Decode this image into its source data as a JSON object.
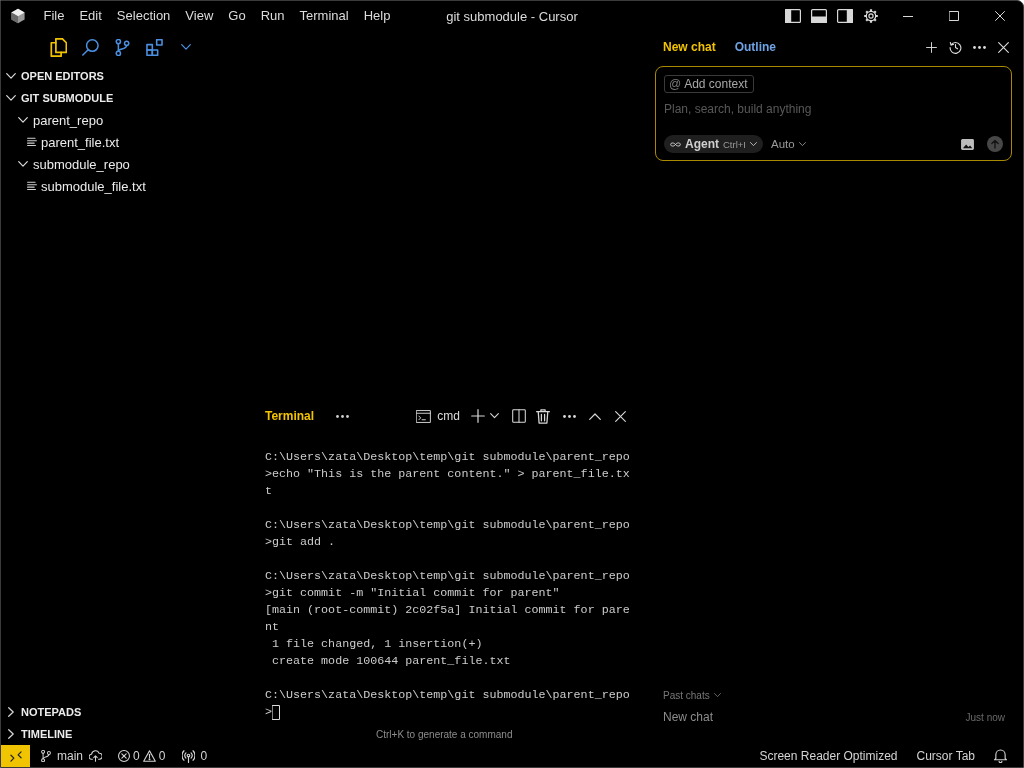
{
  "title_bar": {
    "menu": [
      "File",
      "Edit",
      "Selection",
      "View",
      "Go",
      "Run",
      "Terminal",
      "Help"
    ],
    "title": "git submodule - Cursor",
    "layout_toggles": [
      {
        "on": true
      },
      {
        "on": true
      },
      {
        "on": true
      }
    ]
  },
  "activity_bar": [
    {
      "selected": true
    },
    {
      "selected": false
    },
    {
      "selected": false
    },
    {
      "selected": false
    }
  ],
  "sidebar": {
    "sections": [
      {
        "label": "OPEN EDITORS",
        "expanded": true
      },
      {
        "label": "GIT SUBMODULE",
        "expanded": true,
        "children": [
          {
            "label": "parent_repo",
            "kind": "folder",
            "expanded": true,
            "children": [
              {
                "label": "parent_file.txt",
                "kind": "file"
              }
            ]
          },
          {
            "label": "submodule_repo",
            "kind": "folder",
            "expanded": true,
            "children": [
              {
                "label": "submodule_file.txt",
                "kind": "file"
              }
            ]
          }
        ]
      }
    ],
    "bottom_sections": [
      {
        "label": "NOTEPADS",
        "expanded": false
      },
      {
        "label": "TIMELINE",
        "expanded": false
      }
    ]
  },
  "panel": {
    "tabs": [
      {
        "label": "Terminal",
        "selected": true
      }
    ],
    "shell": "cmd",
    "terminal": {
      "blocks": [
        {
          "lines": [
            "C:\\Users\\zata\\Desktop\\temp\\git submodule\\parent_repo",
            ">echo \"This is the parent content.\" > parent_file.tx",
            "t"
          ]
        },
        {
          "lines": [
            "C:\\Users\\zata\\Desktop\\temp\\git submodule\\parent_repo",
            ">git add ."
          ]
        },
        {
          "lines": [
            "C:\\Users\\zata\\Desktop\\temp\\git submodule\\parent_repo",
            ">git commit -m \"Initial commit for parent\"",
            "[main (root-commit) 2c02f5a] Initial commit for pare",
            "nt",
            " 1 file changed, 1 insertion(+)",
            " create mode 100644 parent_file.txt"
          ]
        },
        {
          "lines": [
            "C:\\Users\\zata\\Desktop\\temp\\git submodule\\parent_repo",
            ">"
          ]
        }
      ]
    },
    "hint": "Ctrl+K to generate a command"
  },
  "chat": {
    "tabs": [
      {
        "label": "New chat",
        "selected": true
      },
      {
        "label": "Outline",
        "selected": false
      }
    ],
    "composer": {
      "context_chip": {
        "symbol": "@",
        "label": "Add context"
      },
      "placeholder": "Plan, search, build anything",
      "mode": {
        "label": "Agent",
        "shortcut": "Ctrl+I"
      },
      "model": "Auto"
    },
    "past_chats": {
      "label": "Past chats",
      "items": [
        {
          "title": "New chat",
          "time": "Just now"
        }
      ]
    }
  },
  "status_bar": {
    "branch": "main",
    "errors": "0",
    "warnings": "0",
    "ports": "0",
    "items": [
      "Screen Reader Optimized",
      "Cursor Tab"
    ]
  }
}
